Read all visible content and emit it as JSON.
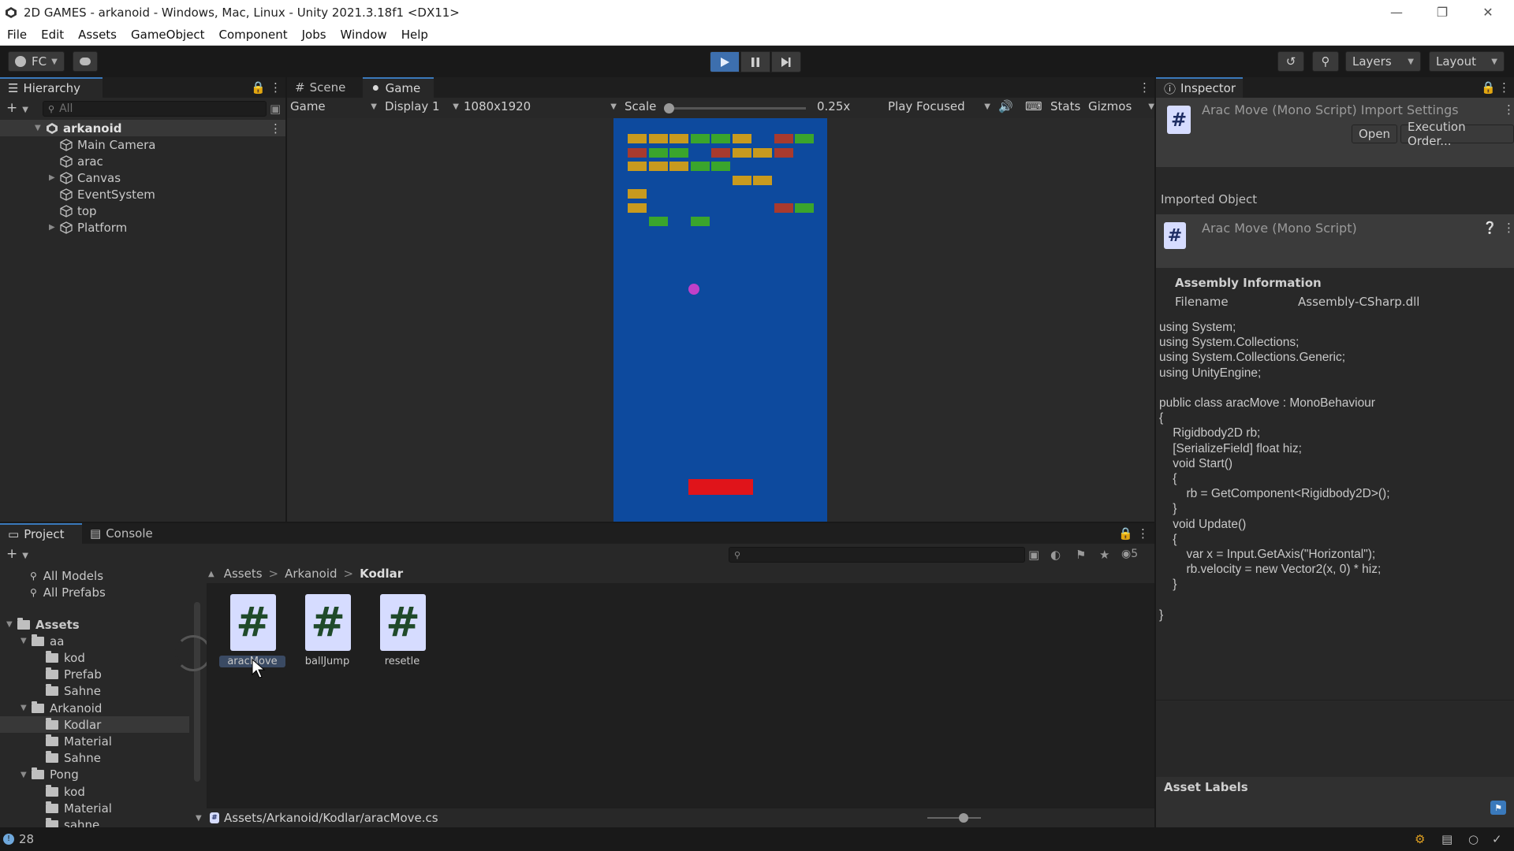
{
  "window": {
    "title": "2D GAMES - arkanoid - Windows, Mac, Linux - Unity 2021.3.18f1 <DX11>",
    "controls": [
      "minimize",
      "restore",
      "close"
    ]
  },
  "menu": [
    "File",
    "Edit",
    "Assets",
    "GameObject",
    "Component",
    "Jobs",
    "Window",
    "Help"
  ],
  "toolbar": {
    "account": "FC",
    "layers": "Layers",
    "layout": "Layout"
  },
  "hierarchy": {
    "tab": "Hierarchy",
    "search_placeholder": "All",
    "scene": "arkanoid",
    "items": [
      {
        "label": "Main Camera",
        "expandable": false
      },
      {
        "label": "arac",
        "expandable": false
      },
      {
        "label": "Canvas",
        "expandable": true
      },
      {
        "label": "EventSystem",
        "expandable": false
      },
      {
        "label": "top",
        "expandable": false
      },
      {
        "label": "Platform",
        "expandable": true
      }
    ]
  },
  "game_view": {
    "tabs": [
      "Scene",
      "Game"
    ],
    "view_mode": "Game",
    "display": "Display 1",
    "resolution": "1080x1920",
    "scale_label": "Scale",
    "scale_value": "0.25x",
    "scale_fraction": 0.0,
    "play_mode": "Play Focused",
    "stats": "Stats",
    "gizmos": "Gizmos",
    "colors": {
      "background": "#0d4a9e",
      "gold": "#c89a1e",
      "green": "#3aa52c",
      "red": "#a83a2e",
      "ball": "#c040c8",
      "paddle": "#e0141a"
    },
    "bricks": [
      [
        "gold",
        "gold",
        "gold",
        "green",
        "green",
        "gold",
        "none",
        "red",
        "green"
      ],
      [
        "red",
        "green",
        "green",
        "none",
        "red",
        "gold",
        "gold",
        "red",
        "none"
      ],
      [
        "gold",
        "gold",
        "gold",
        "green",
        "green",
        "none",
        "none",
        "none",
        "none"
      ],
      [
        "none",
        "none",
        "none",
        "none",
        "none",
        "gold",
        "gold",
        "none",
        "none"
      ],
      [
        "gold",
        "none",
        "none",
        "none",
        "none",
        "none",
        "none",
        "none",
        "none"
      ],
      [
        "gold",
        "none",
        "none",
        "none",
        "none",
        "none",
        "none",
        "red",
        "green"
      ],
      [
        "none",
        "green",
        "none",
        "green",
        "none",
        "none",
        "none",
        "none",
        "none"
      ]
    ]
  },
  "project": {
    "tabs": [
      "Project",
      "Console"
    ],
    "hidden_count": "5",
    "favorites": [
      "All Models",
      "All Prefabs"
    ],
    "tree": [
      {
        "label": "Assets",
        "level": 0,
        "open": true
      },
      {
        "label": "aa",
        "level": 1,
        "open": true
      },
      {
        "label": "kod",
        "level": 2
      },
      {
        "label": "Prefab",
        "level": 2
      },
      {
        "label": "Sahne",
        "level": 2
      },
      {
        "label": "Arkanoid",
        "level": 1,
        "open": true
      },
      {
        "label": "Kodlar",
        "level": 2,
        "selected": true
      },
      {
        "label": "Material",
        "level": 2
      },
      {
        "label": "Sahne",
        "level": 2
      },
      {
        "label": "Pong",
        "level": 1,
        "open": true
      },
      {
        "label": "kod",
        "level": 2
      },
      {
        "label": "Material",
        "level": 2
      },
      {
        "label": "sahne",
        "level": 2
      }
    ],
    "breadcrumb": [
      "Assets",
      "Arkanoid",
      "Kodlar"
    ],
    "assets": [
      {
        "label": "aracMove",
        "selected": true
      },
      {
        "label": "ballJump",
        "selected": false
      },
      {
        "label": "resetle",
        "selected": false
      }
    ],
    "path": "Assets/Arkanoid/Kodlar/aracMove.cs"
  },
  "inspector": {
    "tab": "Inspector",
    "header_title": "Arac Move (Mono Script) Import Settings",
    "open_btn": "Open",
    "exec_btn": "Execution Order...",
    "imported_object": "Imported Object",
    "object_title": "Arac Move (Mono Script)",
    "assembly_info": "Assembly Information",
    "filename_label": "Filename",
    "filename_value": "Assembly-CSharp.dll",
    "code": "using System;\nusing System.Collections;\nusing System.Collections.Generic;\nusing UnityEngine;\n\npublic class aracMove : MonoBehaviour\n{\n    Rigidbody2D rb;\n    [SerializeField] float hiz;\n    void Start()\n    {\n        rb = GetComponent<Rigidbody2D>();\n    }\n    void Update()\n    {\n        var x = Input.GetAxis(\"Horizontal\");\n        rb.velocity = new Vector2(x, 0) * hiz;\n    }\n\n}",
    "asset_labels": "Asset Labels"
  },
  "status": {
    "count": "28"
  }
}
